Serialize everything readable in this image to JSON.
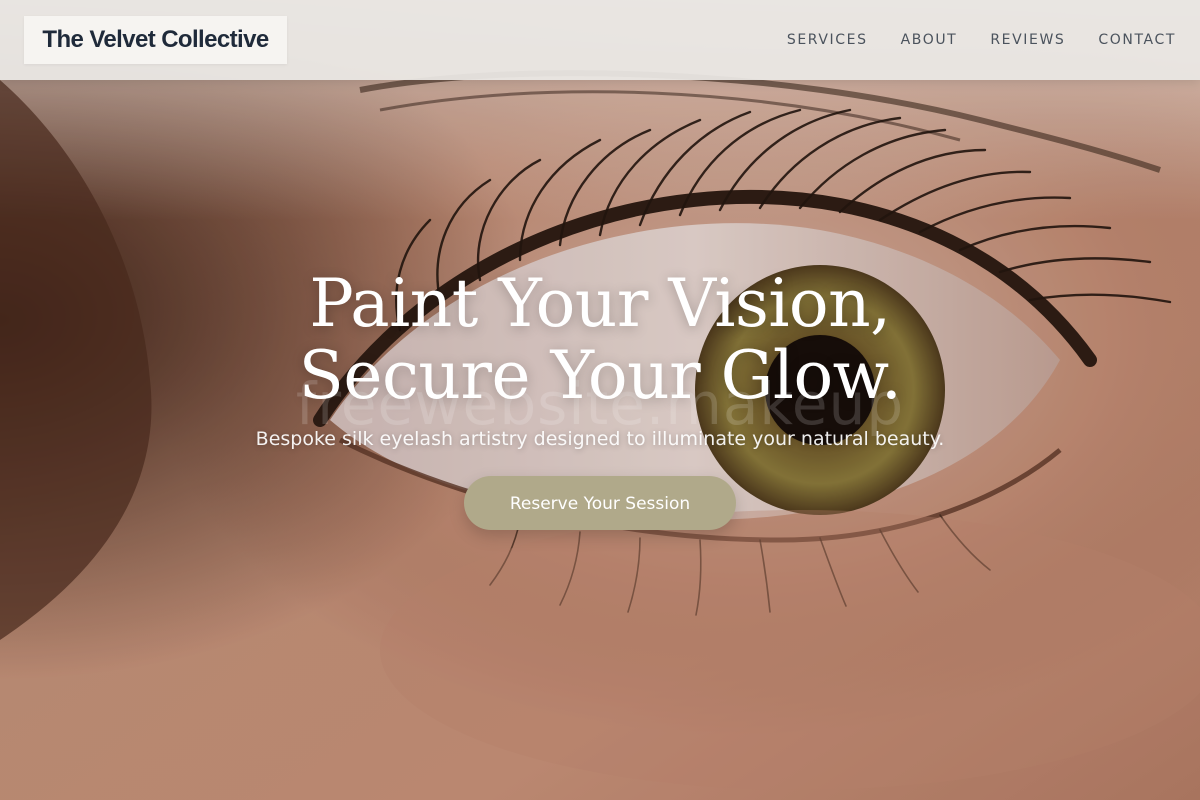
{
  "brand": {
    "name": "The Velvet Collective"
  },
  "nav": {
    "items": [
      "SERVICES",
      "ABOUT",
      "REVIEWS",
      "CONTACT"
    ]
  },
  "hero": {
    "headline_line1": "Paint Your Vision,",
    "headline_line2": "Secure Your Glow.",
    "subtitle": "Bespoke silk eyelash artistry designed to illuminate your natural beauty.",
    "cta_label": "Reserve Your Session",
    "watermark": "freewebsite.makeup",
    "background_image": "close-up-eye-with-lashes"
  },
  "colors": {
    "accent": "#b0a98a",
    "logo_text": "#1f2a3a",
    "nav_text": "#4b535d"
  }
}
